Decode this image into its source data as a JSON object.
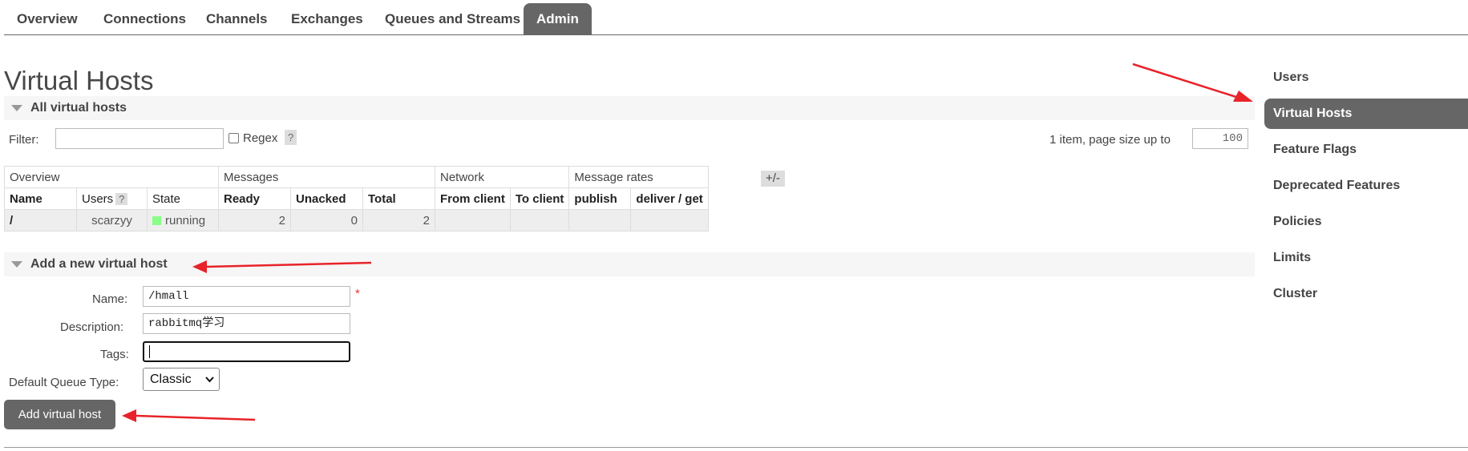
{
  "nav": {
    "tabs": [
      "Overview",
      "Connections",
      "Channels",
      "Exchanges",
      "Queues and Streams",
      "Admin"
    ],
    "active": "Admin"
  },
  "sidebar": {
    "items": [
      "Users",
      "Virtual Hosts",
      "Feature Flags",
      "Deprecated Features",
      "Policies",
      "Limits",
      "Cluster"
    ],
    "active": "Virtual Hosts"
  },
  "page_title": "Virtual Hosts",
  "all_vhosts": {
    "heading": "All virtual hosts",
    "filter_label": "Filter:",
    "filter_value": "",
    "regex_label": "Regex",
    "help": "?",
    "paging_text": "1 item, page size up to",
    "page_size": "100",
    "plus_minus": "+/-",
    "groups": [
      "Overview",
      "Messages",
      "Network",
      "Message rates"
    ],
    "columns": [
      "Name",
      "Users",
      "State",
      "Ready",
      "Unacked",
      "Total",
      "From client",
      "To client",
      "publish",
      "deliver / get"
    ],
    "rows": [
      {
        "name": "/",
        "users": "scarzyy",
        "state": "running",
        "ready": "2",
        "unacked": "0",
        "total": "2",
        "from_client": "",
        "to_client": "",
        "publish": "",
        "deliver_get": ""
      }
    ]
  },
  "add_vhost": {
    "heading": "Add a new virtual host",
    "name_label": "Name:",
    "name_value": "/hmall",
    "required_mark": "*",
    "description_label": "Description:",
    "description_value": "rabbitmq学习",
    "tags_label": "Tags:",
    "tags_value": "",
    "queue_type_label": "Default Queue Type:",
    "queue_type_value": "Classic",
    "submit_label": "Add virtual host"
  },
  "colors": {
    "accent": "#666666",
    "arrow": "#e8232a",
    "running": "#88ff88"
  }
}
